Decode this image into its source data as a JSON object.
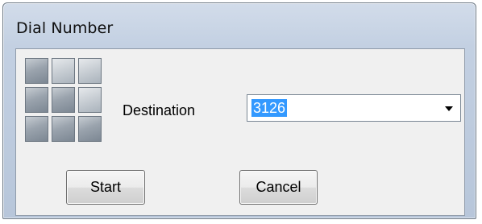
{
  "window": {
    "title": "Dial Number"
  },
  "keypad": {
    "icon": "keypad-icon"
  },
  "destination": {
    "label": "Destination",
    "value": "3126",
    "selected": true
  },
  "buttons": {
    "start": "Start",
    "cancel": "Cancel"
  },
  "colors": {
    "selection": "#3399ff",
    "title_bar": "#c3d0e2",
    "dialog_bg": "#f0f0f0"
  }
}
